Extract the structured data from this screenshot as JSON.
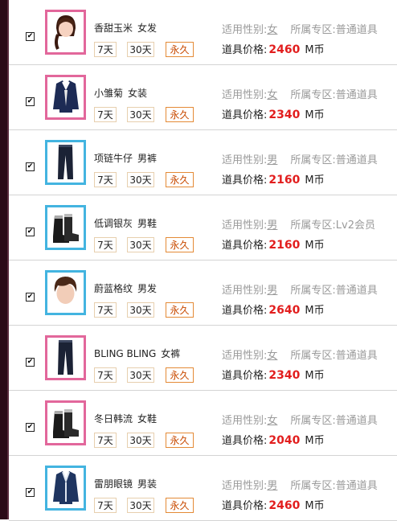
{
  "labels": {
    "gender": "适用性别:",
    "zone": "所属专区:",
    "price": "道具价格:",
    "currency": "M币"
  },
  "durations": {
    "d7": "7天",
    "d30": "30天",
    "perm": "永久"
  },
  "colors": {
    "female_frame": "#e2679b",
    "male_frame": "#43b4e0",
    "price": "#e21e1e",
    "perm_border": "#e48a36",
    "duration_border": "#e7cfae"
  },
  "items": [
    {
      "name": "香甜玉米",
      "type": "女发",
      "gender": "女",
      "zone": "普通道具",
      "price": "2460",
      "checked": "✔",
      "frame": "female",
      "icon": "hair-female-icon"
    },
    {
      "name": "小雏菊",
      "type": "女装",
      "gender": "女",
      "zone": "普通道具",
      "price": "2340",
      "checked": "✔",
      "frame": "female",
      "icon": "jacket-female-icon"
    },
    {
      "name": "项链牛仔",
      "type": "男裤",
      "gender": "男",
      "zone": "普通道具",
      "price": "2160",
      "checked": "✔",
      "frame": "male",
      "icon": "jeans-icon"
    },
    {
      "name": "低调银灰",
      "type": "男鞋",
      "gender": "男",
      "zone": "Lv2会员",
      "price": "2160",
      "checked": "✔",
      "frame": "male",
      "icon": "boots-icon"
    },
    {
      "name": "蔚蓝格纹",
      "type": "男发",
      "gender": "男",
      "zone": "普通道具",
      "price": "2640",
      "checked": "✔",
      "frame": "male",
      "icon": "hair-male-icon"
    },
    {
      "name": "BLING BLING",
      "type": "女裤",
      "gender": "女",
      "zone": "普通道具",
      "price": "2340",
      "checked": "✔",
      "frame": "female",
      "icon": "jeans-icon"
    },
    {
      "name": "冬日韩流",
      "type": "女鞋",
      "gender": "女",
      "zone": "普通道具",
      "price": "2040",
      "checked": "✔",
      "frame": "female",
      "icon": "boots-icon"
    },
    {
      "name": "雷朋眼镜",
      "type": "男装",
      "gender": "男",
      "zone": "普通道具",
      "price": "2460",
      "checked": "✔",
      "frame": "male",
      "icon": "jacket-male-icon"
    }
  ]
}
